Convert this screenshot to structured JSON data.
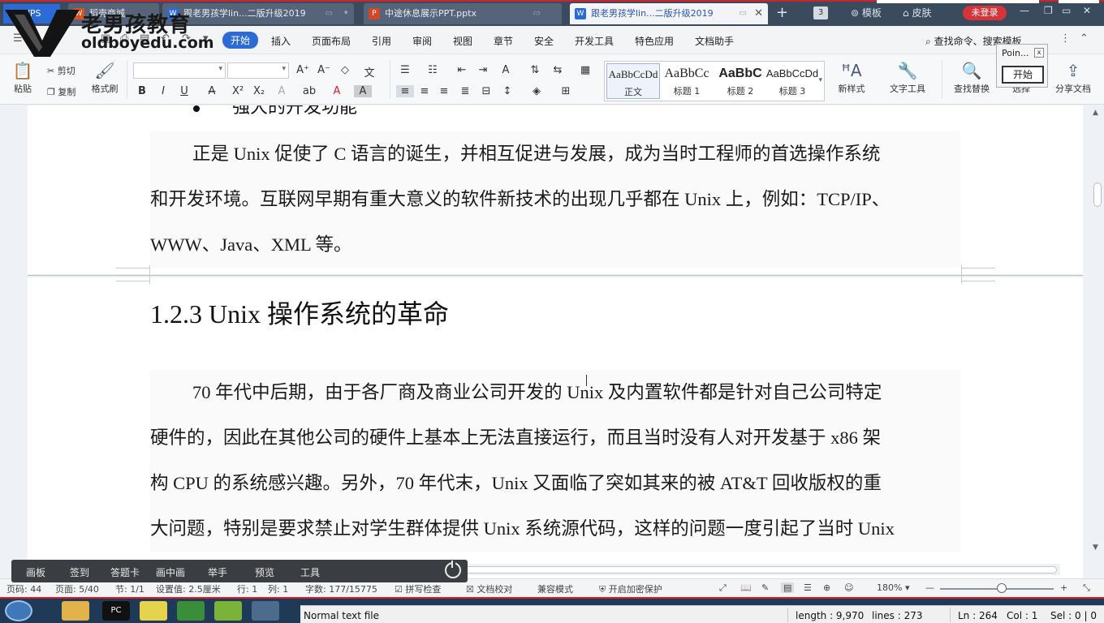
{
  "window": {
    "app_label": "WPS",
    "tabs": [
      {
        "label": "稻壳商城",
        "icon": "wps-writer-icon",
        "color": "#d9531e",
        "active": false
      },
      {
        "label": "跟老男孩学lin...二版升级2019",
        "icon": "wps-writer-icon",
        "color": "#2c6bd5",
        "active": false
      },
      {
        "label": "中途休息展示PPT.pptx",
        "icon": "wps-presentation-icon",
        "color": "#d24726",
        "active": false
      },
      {
        "label": "跟老男孩学lin...二版升级2019",
        "icon": "wps-writer-icon",
        "color": "#2c6bd5",
        "active": true
      }
    ],
    "tab_count": "3",
    "template_label": "模板",
    "skin_label": "皮肤",
    "login_label": "未登录"
  },
  "menubar": {
    "file_label": "文",
    "items": [
      "开始",
      "插入",
      "页面布局",
      "引用",
      "审阅",
      "视图",
      "章节",
      "安全",
      "开发工具",
      "特色应用",
      "文档助手"
    ],
    "active_item": "开始",
    "search_label": "查找命令、搜索模板"
  },
  "ribbon": {
    "paste": "粘贴",
    "cut": "剪切",
    "copy": "复制",
    "format_painter": "格式刷",
    "styles": [
      {
        "sample": "AaBbCcDd",
        "name": "正文"
      },
      {
        "sample": "AaBbCc",
        "name": "标题 1"
      },
      {
        "sample": "AaBbC",
        "name": "标题 2"
      },
      {
        "sample": "AaBbCcDd",
        "name": "标题 3"
      }
    ],
    "new_style": "新样式",
    "text_tools": "文字工具",
    "find_replace": "查找替换",
    "select": "选择",
    "share_doc": "分享文档"
  },
  "pointer_dialog": {
    "title": "Poin...",
    "close": "x",
    "button": "开始"
  },
  "document": {
    "bullet_heading": "强大的开发功能",
    "para1": [
      "正是 Unix 促使了 C 语言的诞生，并相互促进与发展，成为当时工程师的首选操作系统",
      "和开发环境。互联网早期有重大意义的软件新技术的出现几乎都在 Unix 上，例如：TCP/IP、",
      "WWW、Java、XML 等。"
    ],
    "heading": "1.2.3 Unix 操作系统的革命",
    "para2": [
      "70 年代中后期，由于各厂商及商业公司开发的 Unix 及内置软件都是针对自己公司特定",
      "硬件的，因此在其他公司的硬件上基本上无法直接运行，而且当时没有人对开发基于 x86 架",
      "构 CPU 的系统感兴趣。另外，70 年代末，Unix 又面临了突如其来的被 AT&T 回收版权的重",
      "大问题，特别是要求禁止对学生群体提供 Unix 系统源代码，这样的问题一度引起了当时 Unix"
    ]
  },
  "overlay_toolbar": {
    "items": [
      "画板",
      "签到",
      "答题卡",
      "画中画",
      "举手",
      "预览",
      "工具"
    ]
  },
  "statusbar": {
    "page_num": "页码: 44",
    "page": "页面: 5/40",
    "section": "节: 1/1",
    "setting": "设置值: 2.5厘米",
    "row": "行: 1",
    "col": "列: 1",
    "words": "字数: 177/15775",
    "spell": "拼写检查",
    "doc_check": "文档校对",
    "compat": "兼容模式",
    "encrypt": "开启加密保护",
    "zoom": "180%",
    "zoom_level": 0.54
  },
  "watermark": {
    "name_cn": "老男孩教育",
    "name_en": "oldboyedu.com"
  },
  "notepad_status": {
    "mode": "Normal text file",
    "length": "length : 9,970",
    "lines": "lines : 273",
    "ln": "Ln : 264",
    "col": "Col : 1",
    "sel": "Sel : 0 | 0"
  },
  "taskbar": {
    "apps": [
      {
        "icon": "explorer-icon",
        "label": ""
      },
      {
        "icon": "pycharm-icon",
        "label": "PC"
      },
      {
        "icon": "sticky-notes-icon",
        "label": ""
      },
      {
        "icon": "chrome-icon",
        "label": ""
      },
      {
        "icon": "app-icon",
        "label": ""
      },
      {
        "icon": "remote-desktop-icon",
        "label": ""
      }
    ]
  }
}
